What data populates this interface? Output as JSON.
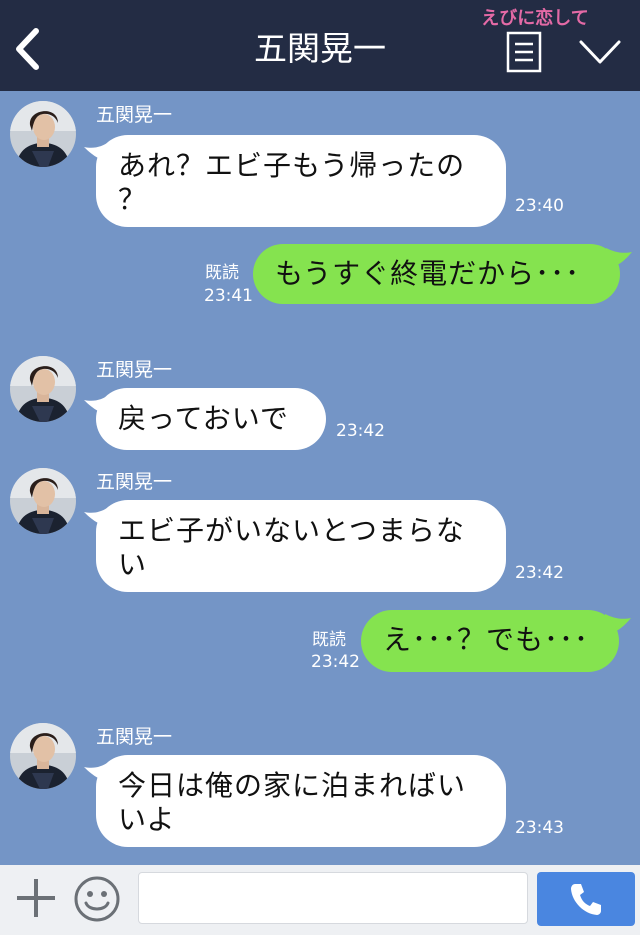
{
  "header": {
    "title": "五関晃一",
    "watermark": "えびに恋して",
    "back_icon": "chevron-left-icon",
    "menu_icon": "menu-icon",
    "collapse_icon": "chevron-down-icon"
  },
  "messages": [
    {
      "side": "in",
      "sender": "五関晃一",
      "lines": [
        "あれ？エビ子もう帰ったの",
        "？"
      ],
      "time": "23:40"
    },
    {
      "side": "out",
      "read": "既読",
      "lines": [
        "もうすぐ終電だから･･･"
      ],
      "time": "23:41"
    },
    {
      "side": "in",
      "sender": "五関晃一",
      "lines": [
        "戻っておいで"
      ],
      "time": "23:42"
    },
    {
      "side": "in",
      "sender": "五関晃一",
      "lines": [
        "エビ子がいないとつまらな",
        "い"
      ],
      "time": "23:42"
    },
    {
      "side": "out",
      "read": "既読",
      "lines": [
        "え･･･？でも･･･"
      ],
      "time": "23:42"
    },
    {
      "side": "in",
      "sender": "五関晃一",
      "lines": [
        "今日は俺の家に泊まればい",
        "いよ"
      ],
      "time": "23:43"
    }
  ],
  "input": {
    "plus_icon": "plus-icon",
    "emoji_icon": "smiley-icon",
    "call_icon": "phone-icon",
    "value": "",
    "placeholder": ""
  },
  "colors": {
    "header": "#232c44",
    "background": "#7495c6",
    "incoming": "#ffffff",
    "outgoing": "#85e34f",
    "accent": "#4a86e0",
    "watermark": "#e46aa6"
  }
}
